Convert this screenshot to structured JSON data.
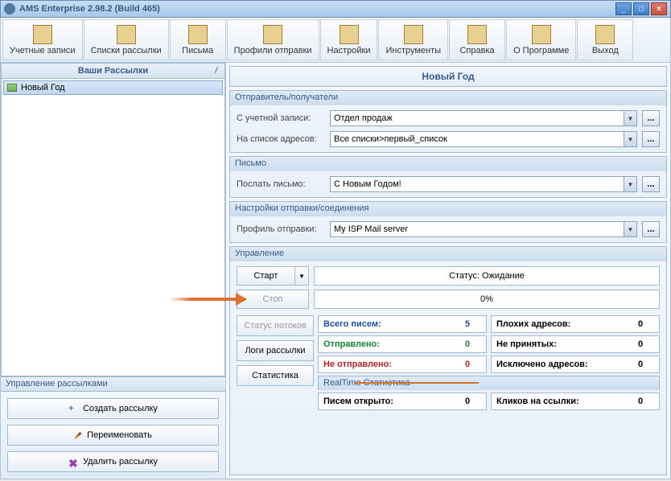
{
  "window": {
    "title": "AMS Enterprise 2.98.2 (Build 465)"
  },
  "toolbar": [
    {
      "name": "accounts",
      "label": "Учетные записи"
    },
    {
      "name": "lists",
      "label": "Списки рассылки"
    },
    {
      "name": "letters",
      "label": "Письма"
    },
    {
      "name": "profiles",
      "label": "Профили отправки"
    },
    {
      "name": "settings",
      "label": "Настройки"
    },
    {
      "name": "tools",
      "label": "Инструменты"
    },
    {
      "name": "help",
      "label": "Справка"
    },
    {
      "name": "about",
      "label": "О Программе"
    },
    {
      "name": "exit",
      "label": "Выход"
    }
  ],
  "left": {
    "panel_title": "Ваши Рассылки",
    "tree_item": "Новый Год",
    "manage_title": "Управление рассылками",
    "create": "Создать рассылку",
    "rename": "Переименовать",
    "delete": "Удалить рассылку"
  },
  "campaign": {
    "title": "Новый Год",
    "sender_group": "Отправитель/получатели",
    "from_account_label": "С учетной записи:",
    "from_account_value": "Отдел продаж",
    "to_list_label": "На список адресов:",
    "to_list_value": "Все списки>первый_список",
    "letter_group": "Письмо",
    "send_letter_label": "Послать письмо:",
    "send_letter_value": "С Новым Годом!",
    "conn_group": "Настройки отправки/соединения",
    "profile_label": "Профиль отправки:",
    "profile_value": "My ISP Mail server",
    "control_group": "Управление",
    "start": "Старт",
    "stop": "Стоп",
    "status_label": "Статус: Ожидание",
    "progress": "0%",
    "threads": "Статус потоков",
    "logs": "Логи рассылки",
    "stats": "Статистика",
    "total_label": "Всего писем:",
    "total_val": "5",
    "sent_label": "Отправлено:",
    "sent_val": "0",
    "notsent_label": "Не отправлено:",
    "notsent_val": "0",
    "bad_label": "Плохих адресов:",
    "bad_val": "0",
    "rejected_label": "Не принятых:",
    "rejected_val": "0",
    "excluded_label": "Исключено адресов:",
    "excluded_val": "0",
    "rt_title": "RealTime Статистика",
    "opened_label": "Писем открыто:",
    "opened_val": "0",
    "clicks_label": "Кликов на ссылки:",
    "clicks_val": "0"
  }
}
